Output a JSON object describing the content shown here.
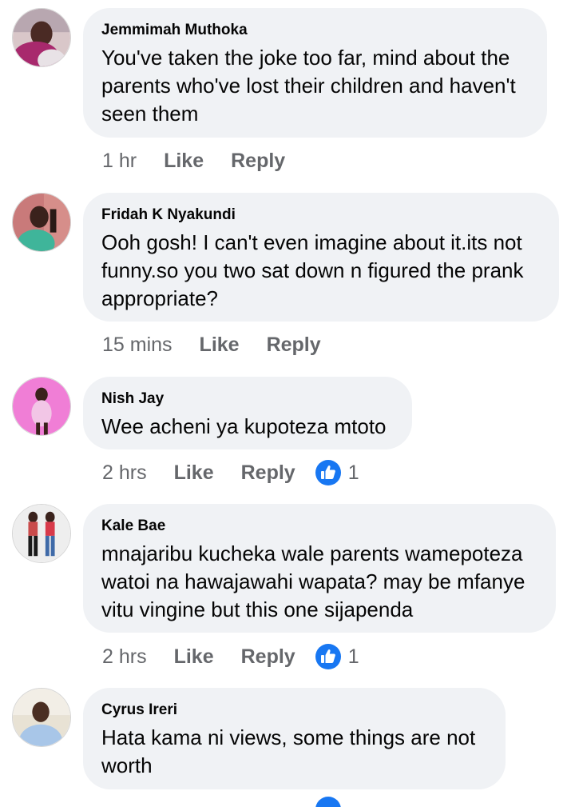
{
  "comments": [
    {
      "author": "Jemmimah Muthoka",
      "text": "You've taken the joke too far, mind about the\nparents who've lost their children and haven't\nseen them",
      "time": "1 hr",
      "like_label": "Like",
      "reply_label": "Reply",
      "reactions": null
    },
    {
      "author": "Fridah K Nyakundi",
      "text": "Ooh gosh! I can't even imagine about it.its not\nfunny.so you two sat down n figured the prank\nappropriate?",
      "time": "15 mins",
      "like_label": "Like",
      "reply_label": "Reply",
      "reactions": null
    },
    {
      "author": "Nish Jay",
      "text": "Wee acheni ya kupoteza mtoto",
      "time": "2 hrs",
      "like_label": "Like",
      "reply_label": "Reply",
      "reactions": "1"
    },
    {
      "author": "Kale Bae",
      "text": "mnajaribu kucheka wale parents wamepoteza\nwatoi na hawajawahi wapata? may be mfanye\nvitu vingine but this one sijapenda",
      "time": "2 hrs",
      "like_label": "Like",
      "reply_label": "Reply",
      "reactions": "1"
    },
    {
      "author": "Cyrus Ireri",
      "text": "Hata kama ni views, some things are not\nworth",
      "time": null,
      "like_label": null,
      "reply_label": null,
      "reactions": null
    }
  ],
  "icons": {
    "reaction": "like-thumbs-up-icon",
    "avatar": "avatar-photo"
  },
  "colors": {
    "bubble": "#f0f2f5",
    "meta_text": "#65676b",
    "like_blue": "#1877f2"
  }
}
